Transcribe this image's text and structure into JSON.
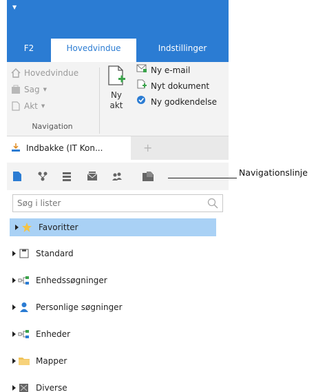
{
  "ribbon_tabs": [
    "F2",
    "Hovedvindue",
    "Indstillinger"
  ],
  "navigation_group": {
    "items": [
      "Hovedvindue",
      "Sag",
      "Akt"
    ],
    "label": "Navigation"
  },
  "new_act": {
    "label_line1": "Ny",
    "label_line2": "akt"
  },
  "new_items": [
    "Ny e-mail",
    "Nyt dokument",
    "Ny godkendelse"
  ],
  "document_tab": {
    "label": "Indbakke (IT Kon..."
  },
  "navbar_icons": [
    "document-icon",
    "org-tree-icon",
    "list-icon",
    "mail-stack-icon",
    "people-icon",
    "folder-doc-icon"
  ],
  "search": {
    "placeholder": "Søg i lister"
  },
  "tree": [
    {
      "label": "Favoritter",
      "icon": "star-icon",
      "selected": true
    },
    {
      "label": "Standard",
      "icon": "square-icon"
    },
    {
      "label": "Enhedssøgninger",
      "icon": "unit-search-icon"
    },
    {
      "label": "Personlige søgninger",
      "icon": "person-icon"
    },
    {
      "label": "Enheder",
      "icon": "units-icon"
    },
    {
      "label": "Mapper",
      "icon": "folder-icon"
    },
    {
      "label": "Diverse",
      "icon": "misc-icon"
    }
  ],
  "callout": {
    "text": "Navigationslinje"
  },
  "colors": {
    "accent": "#2b7cd3",
    "selection": "#a9d1f5"
  }
}
